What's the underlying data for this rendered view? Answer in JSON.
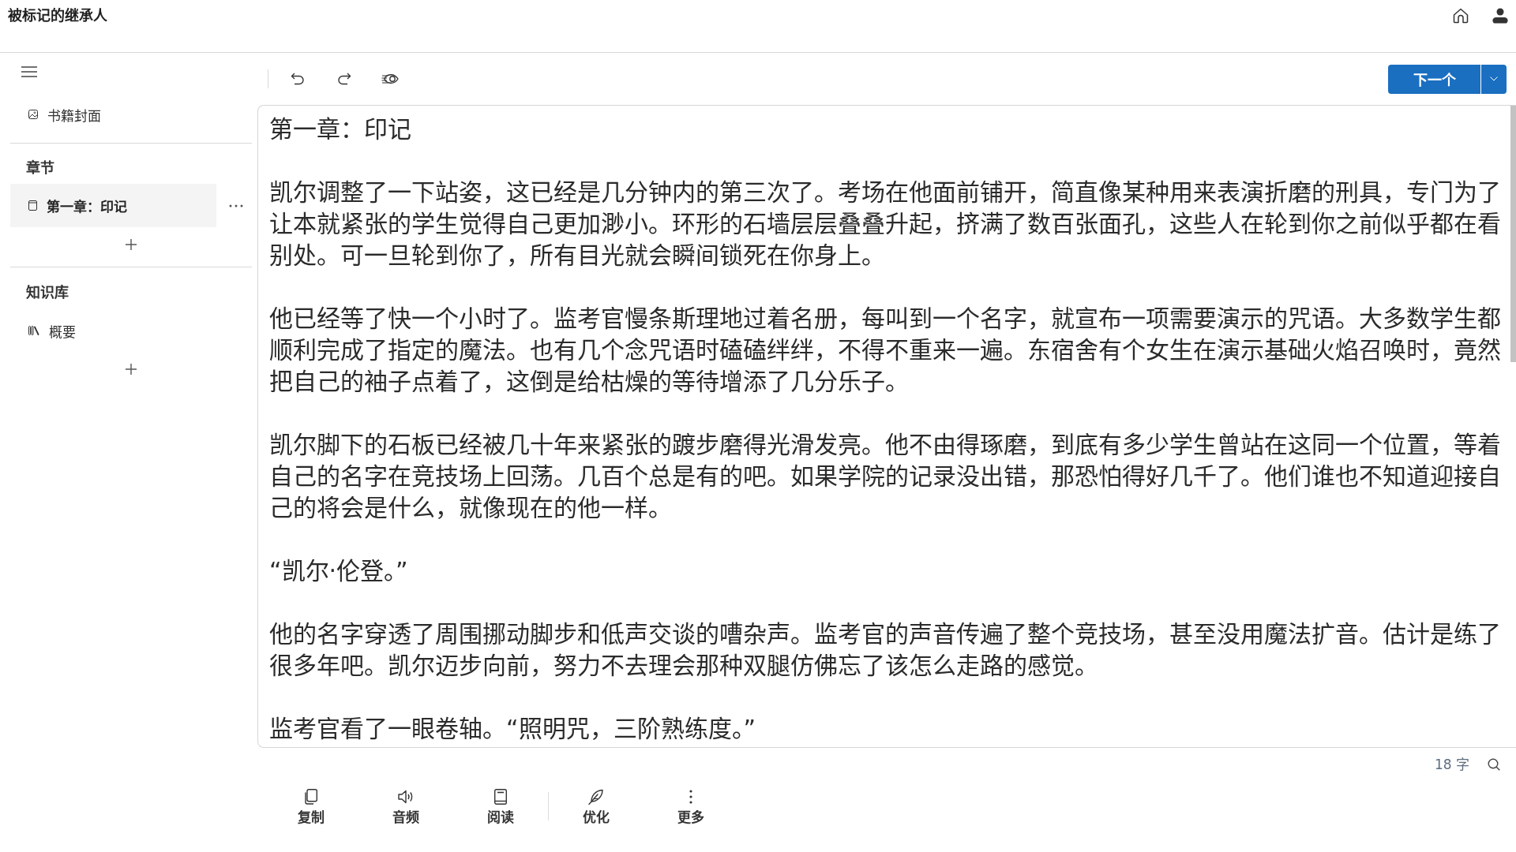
{
  "header": {
    "title": "被标记的继承人"
  },
  "sidebar": {
    "items": [
      {
        "kind": "cover",
        "label": "书籍封面",
        "selected": false
      }
    ],
    "sections": [
      {
        "heading": "章节",
        "items": [
          {
            "kind": "chapter",
            "label": "第一章：印记",
            "selected": true
          }
        ]
      },
      {
        "heading": "知识库",
        "items": [
          {
            "kind": "summary",
            "label": "概要",
            "selected": false
          }
        ]
      }
    ]
  },
  "toolbar": {
    "next_button": {
      "label": "下一个"
    }
  },
  "editor": {
    "title": "第一章：印记",
    "paragraphs": [
      "凯尔调整了一下站姿，这已经是几分钟内的第三次了。考场在他面前铺开，简直像某种用来表演折磨的刑具，专门为了让本就紧张的学生觉得自己更加渺小。环形的石墙层层叠叠升起，挤满了数百张面孔，这些人在轮到你之前似乎都在看别处。可一旦轮到你了，所有目光就会瞬间锁死在你身上。",
      "他已经等了快一个小时了。监考官慢条斯理地过着名册，每叫到一个名字，就宣布一项需要演示的咒语。大多数学生都顺利完成了指定的魔法。也有几个念咒语时磕磕绊绊，不得不重来一遍。东宿舍有个女生在演示基础火焰召唤时，竟然把自己的袖子点着了，这倒是给枯燥的等待增添了几分乐子。",
      "凯尔脚下的石板已经被几十年来紧张的踱步磨得光滑发亮。他不由得琢磨，到底有多少学生曾站在这同一个位置，等着自己的名字在竞技场上回荡。几百个总是有的吧。如果学院的记录没出错，那恐怕得好几千了。他们谁也不知道迎接自己的将会是什么，就像现在的他一样。",
      "“凯尔·伦登。”",
      "他的名字穿透了周围挪动脚步和低声交谈的嘈杂声。监考官的声音传遍了整个竞技场，甚至没用魔法扩音。估计是练了很多年吧。凯尔迈步向前，努力不去理会那种双腿仿佛忘了该怎么走路的感觉。",
      "监考官看了一眼卷轴。“照明咒，三阶熟练度。”"
    ]
  },
  "status_bar": {
    "word_count": "18 字"
  },
  "bottom_bar": {
    "groups": [
      {
        "actions": [
          {
            "kind": "copy",
            "label": "复制"
          },
          {
            "kind": "audio",
            "label": "音频"
          },
          {
            "kind": "read",
            "label": "阅读"
          }
        ]
      },
      {
        "actions": [
          {
            "kind": "optimize",
            "label": "优化"
          },
          {
            "kind": "more",
            "label": "更多"
          }
        ]
      }
    ]
  }
}
